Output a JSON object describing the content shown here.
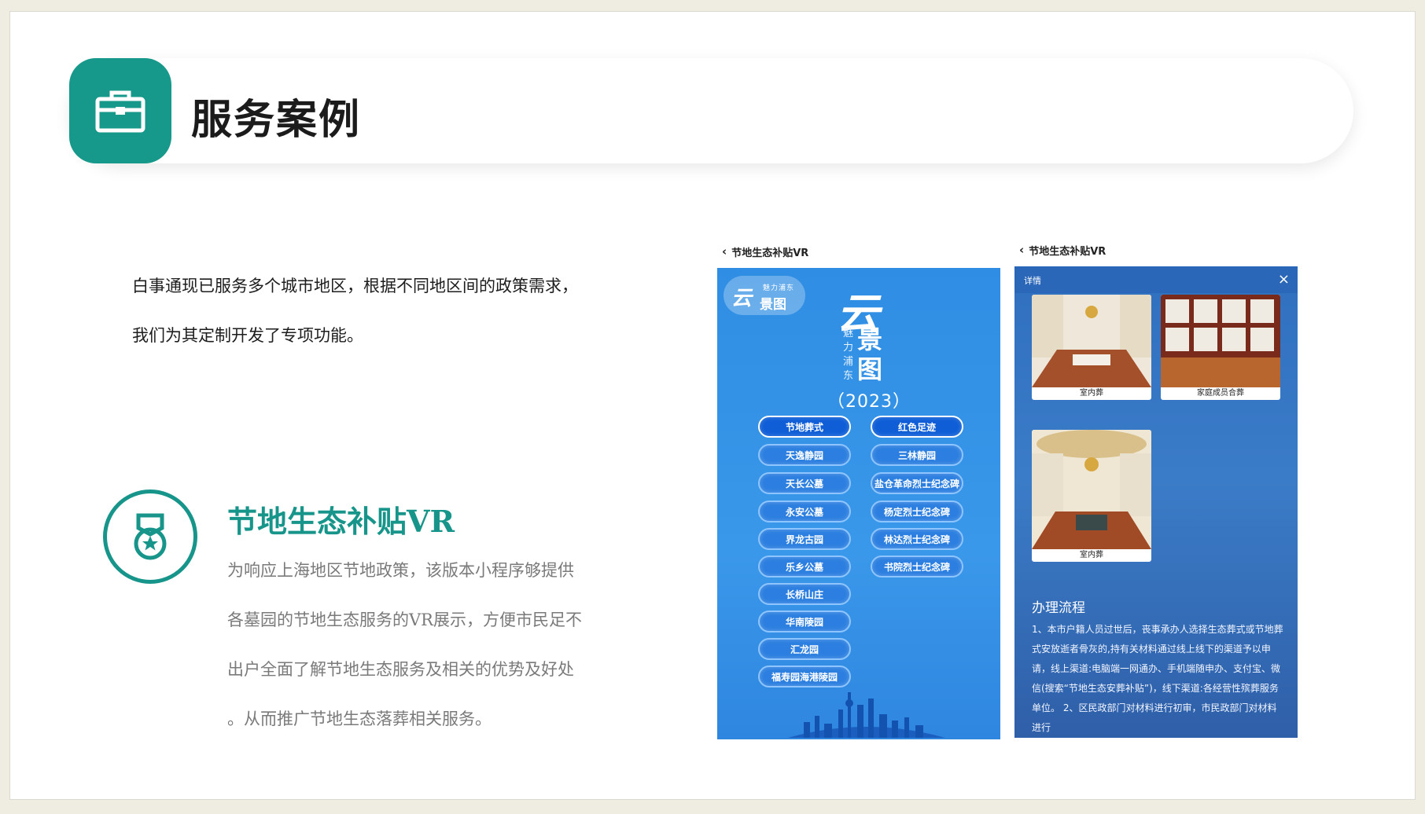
{
  "header": {
    "title": "服务案例",
    "icon": "briefcase-icon",
    "accent": "#16988a"
  },
  "intro": {
    "line1": "白事通现已服务多个城市地区，根据不同地区间的政策需求，",
    "line2": "我们为其定制开发了专项功能。"
  },
  "feature": {
    "icon": "medal-icon",
    "title": "节地生态补贴VR",
    "lines": [
      "为响应上海地区节地政策，该版本小程序够提供",
      "各墓园的节地生态服务的VR展示，方便市民足不",
      "出户全面了解节地生态服务及相关的优势及好处",
      "。从而推广节地生态落葬相关服务。"
    ]
  },
  "phone1": {
    "nav_title": "节地生态补贴VR",
    "logo_small": "魅力浦东",
    "logo_yun": "云",
    "logo_jt": "景图",
    "big_yun": "云",
    "vert_small": "魅力浦东",
    "vert_big": "景图",
    "year": "（2023）",
    "left_buttons": [
      "节地葬式",
      "天逸静园",
      "天长公墓",
      "永安公墓",
      "界龙古园",
      "乐乡公墓",
      "长桥山庄",
      "华南陵园",
      "汇龙园",
      "福寿园海港陵园"
    ],
    "right_buttons": [
      "红色足迹",
      "三林静园",
      "盐仓革命烈士纪念碑",
      "杨定烈士纪念碑",
      "林达烈士纪念碑",
      "书院烈士纪念碑"
    ]
  },
  "phone2": {
    "nav_title": "节地生态补贴VR",
    "header_label": "详情",
    "close_glyph": "×",
    "cards": [
      "室内葬",
      "家庭成员合葬",
      "室内葬"
    ],
    "process_title": "办理流程",
    "process_text": "1、本市户籍人员过世后，丧事承办人选择生态葬式或节地葬式安放逝者骨灰的,持有关材料通过线上线下的渠道予以申请，线上渠道:电脑端一网通办、手机端随申办、支付宝、微信(搜索“节地生态安葬补贴”)，线下渠道:各经营性殡葬服务单位。 2、区民政部门对材料进行初审，市民政部门对材料进行"
  }
}
